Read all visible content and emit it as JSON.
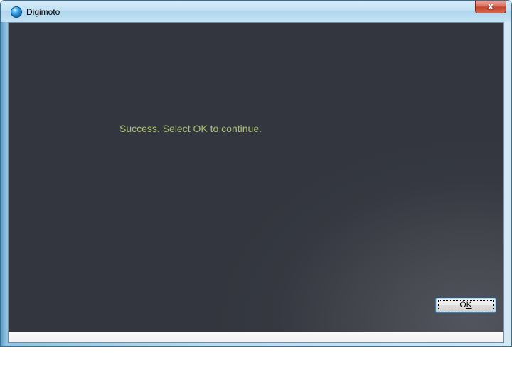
{
  "window": {
    "title": "Digimoto",
    "icon": "digimoto-app-icon",
    "close_label": "x",
    "close_icon": "close-icon"
  },
  "content": {
    "message": "Success. Select OK to continue.",
    "message_color": "#a8c272",
    "background_color": "#33363e"
  },
  "buttons": {
    "ok_prefix": "O",
    "ok_mnemonic": "K"
  },
  "colors": {
    "titlebar": "#c2e0f2",
    "close_button": "#c24630",
    "button_bar": "#f0f0f0"
  }
}
